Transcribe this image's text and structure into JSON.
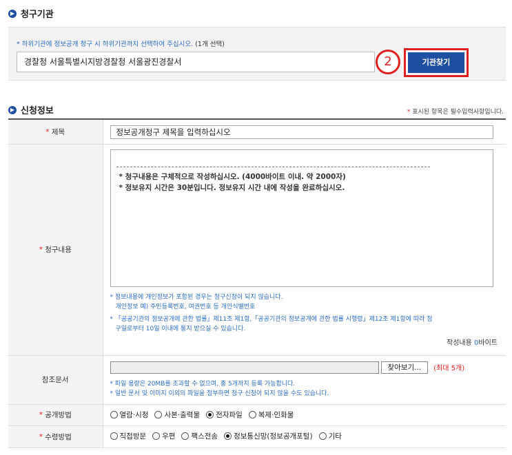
{
  "agency_section": {
    "title": "청구기관",
    "note": "* 하위기관에 정보공개 청구 시 하위기관까지 선택하여 주십시오.",
    "count": "(1개 선택)",
    "selected_value": "경찰청 서울특별시지방경찰청 서울광진경찰서",
    "step_number": "2",
    "find_button": "기관찾기"
  },
  "apply_section": {
    "title": "신청정보",
    "required_note": "표시된 항목은 필수입력사항입니다.",
    "required_star": "*"
  },
  "form": {
    "subject": {
      "label": "제목",
      "value": "정보공개청구 제목을 입력하십시오"
    },
    "content": {
      "label": "청구내용",
      "guide1": "* 청구내용은 구체적으로 작성하십시오. (4000바이트 이내. 약 2000자)",
      "guide2": "* 정보유지 시간은 30분입니다. 정보유지 시간 내에 작성을 완료하십시오.",
      "note1a": "* 정보내용에 개인정보가 포함된 경우는 청구신청이 되지 않습니다.",
      "note1b": "개인정보 예) 주민등록번호, 여권번호 등 개인식별번호",
      "note2a": "* 「공공기관의 정보공개에 관한 법률」제11조 제1항,「공공기관의 정보공개에 관한 법률 시행령」제12조 제1항에 따라 청",
      "note2b": "구일로부터 10일 이내에 통지 받으실 수 있습니다.",
      "byte_label": "작성내용",
      "byte_count": "0",
      "byte_unit": "바이트"
    },
    "attachments": {
      "label": "참조문서",
      "browse_button": "찾아보기...",
      "max_files": "(최대 5개)",
      "note1": "* 파일 용량은 20MB를 초과할 수 없으며, 총 5개까지 등록 가능합니다.",
      "note2": "* 일반 문서 및 이미지 이외의 파일을 첨부하면 청구 신청이 되지 않을 수도 있습니다."
    },
    "disclosure": {
      "label": "공개방법",
      "options": [
        "열람·시청",
        "사본·출력물",
        "전자파일",
        "복제·인화물"
      ],
      "selected_index": 2
    },
    "receipt": {
      "label": "수령방법",
      "options": [
        "직접방문",
        "우편",
        "팩스전송",
        "정보통신망(정보공개포털)",
        "기타"
      ],
      "selected_index": 3
    }
  },
  "colors": {
    "accent_blue": "#1f4fa0",
    "note_blue": "#2a6cc6",
    "highlight_red": "#e02020"
  }
}
